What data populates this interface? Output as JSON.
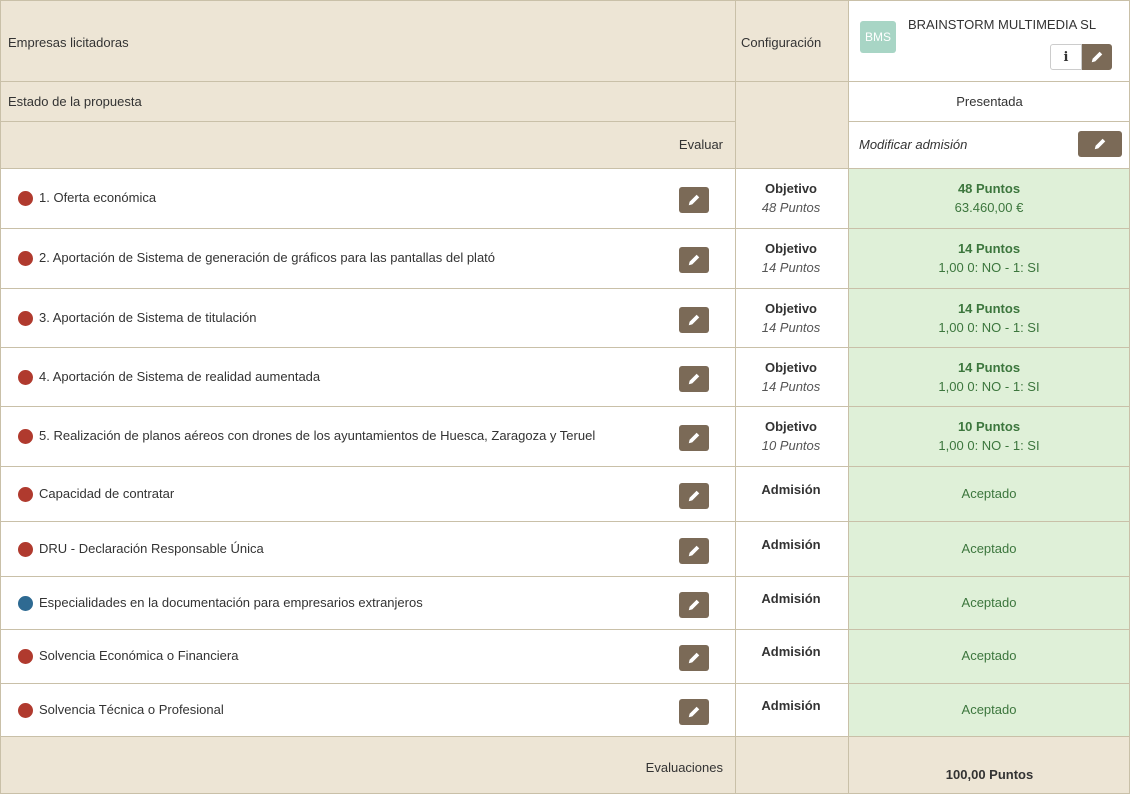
{
  "header": {
    "companies_label": "Empresas licitadoras",
    "config_label": "Configuración",
    "company_name": "BRAINSTORM MULTIMEDIA SL",
    "company_logo_text": "BMS",
    "info_label": "i"
  },
  "status_row": {
    "label": "Estado de la propuesta",
    "value": "Presentada"
  },
  "evaluate_row": {
    "label": "Evaluar",
    "modify_label": "Modificar admisión"
  },
  "criteria": [
    {
      "label": "1. Oferta económica",
      "dot_color": "#b03a2e",
      "type": "Objetivo",
      "points": "48 Puntos",
      "score": "48 Puntos",
      "detail": "63.460,00 €"
    },
    {
      "label": "2. Aportación de Sistema de generación de gráficos para las pantallas del plató",
      "dot_color": "#b03a2e",
      "type": "Objetivo",
      "points": "14 Puntos",
      "score": "14 Puntos",
      "detail": "1,00 0: NO - 1: SI"
    },
    {
      "label": "3. Aportación de Sistema de titulación",
      "dot_color": "#b03a2e",
      "type": "Objetivo",
      "points": "14 Puntos",
      "score": "14 Puntos",
      "detail": "1,00 0: NO - 1: SI"
    },
    {
      "label": "4. Aportación de Sistema de realidad aumentada",
      "dot_color": "#b03a2e",
      "type": "Objetivo",
      "points": "14 Puntos",
      "score": "14 Puntos",
      "detail": "1,00 0: NO - 1: SI"
    },
    {
      "label": "5. Realización de planos aéreos con drones de los ayuntamientos de Huesca, Zaragoza y Teruel",
      "dot_color": "#b03a2e",
      "type": "Objetivo",
      "points": "10 Puntos",
      "score": "10 Puntos",
      "detail": "1,00 0: NO - 1: SI"
    },
    {
      "label": "Capacidad de contratar",
      "dot_color": "#b03a2e",
      "type": "Admisión",
      "result": "Aceptado"
    },
    {
      "label": "DRU - Declaración Responsable Única",
      "dot_color": "#b03a2e",
      "type": "Admisión",
      "result": "Aceptado"
    },
    {
      "label": "Especialidades en la documentación para empresarios extranjeros",
      "dot_color": "#2e6a92",
      "type": "Admisión",
      "result": "Aceptado"
    },
    {
      "label": "Solvencia Económica o Financiera",
      "dot_color": "#b03a2e",
      "type": "Admisión",
      "result": "Aceptado"
    },
    {
      "label": "Solvencia Técnica o Profesional",
      "dot_color": "#b03a2e",
      "type": "Admisión",
      "result": "Aceptado"
    }
  ],
  "footer": {
    "label": "Evaluaciones",
    "total": "100,00 Puntos"
  }
}
